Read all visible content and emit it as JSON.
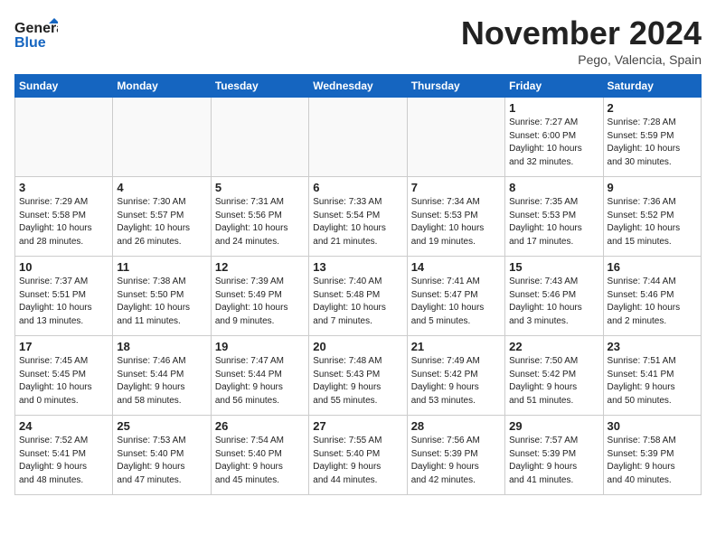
{
  "header": {
    "logo_general": "General",
    "logo_blue": "Blue",
    "month": "November 2024",
    "location": "Pego, Valencia, Spain"
  },
  "weekdays": [
    "Sunday",
    "Monday",
    "Tuesday",
    "Wednesday",
    "Thursday",
    "Friday",
    "Saturday"
  ],
  "weeks": [
    [
      {
        "day": "",
        "info": ""
      },
      {
        "day": "",
        "info": ""
      },
      {
        "day": "",
        "info": ""
      },
      {
        "day": "",
        "info": ""
      },
      {
        "day": "",
        "info": ""
      },
      {
        "day": "1",
        "info": "Sunrise: 7:27 AM\nSunset: 6:00 PM\nDaylight: 10 hours\nand 32 minutes."
      },
      {
        "day": "2",
        "info": "Sunrise: 7:28 AM\nSunset: 5:59 PM\nDaylight: 10 hours\nand 30 minutes."
      }
    ],
    [
      {
        "day": "3",
        "info": "Sunrise: 7:29 AM\nSunset: 5:58 PM\nDaylight: 10 hours\nand 28 minutes."
      },
      {
        "day": "4",
        "info": "Sunrise: 7:30 AM\nSunset: 5:57 PM\nDaylight: 10 hours\nand 26 minutes."
      },
      {
        "day": "5",
        "info": "Sunrise: 7:31 AM\nSunset: 5:56 PM\nDaylight: 10 hours\nand 24 minutes."
      },
      {
        "day": "6",
        "info": "Sunrise: 7:33 AM\nSunset: 5:54 PM\nDaylight: 10 hours\nand 21 minutes."
      },
      {
        "day": "7",
        "info": "Sunrise: 7:34 AM\nSunset: 5:53 PM\nDaylight: 10 hours\nand 19 minutes."
      },
      {
        "day": "8",
        "info": "Sunrise: 7:35 AM\nSunset: 5:53 PM\nDaylight: 10 hours\nand 17 minutes."
      },
      {
        "day": "9",
        "info": "Sunrise: 7:36 AM\nSunset: 5:52 PM\nDaylight: 10 hours\nand 15 minutes."
      }
    ],
    [
      {
        "day": "10",
        "info": "Sunrise: 7:37 AM\nSunset: 5:51 PM\nDaylight: 10 hours\nand 13 minutes."
      },
      {
        "day": "11",
        "info": "Sunrise: 7:38 AM\nSunset: 5:50 PM\nDaylight: 10 hours\nand 11 minutes."
      },
      {
        "day": "12",
        "info": "Sunrise: 7:39 AM\nSunset: 5:49 PM\nDaylight: 10 hours\nand 9 minutes."
      },
      {
        "day": "13",
        "info": "Sunrise: 7:40 AM\nSunset: 5:48 PM\nDaylight: 10 hours\nand 7 minutes."
      },
      {
        "day": "14",
        "info": "Sunrise: 7:41 AM\nSunset: 5:47 PM\nDaylight: 10 hours\nand 5 minutes."
      },
      {
        "day": "15",
        "info": "Sunrise: 7:43 AM\nSunset: 5:46 PM\nDaylight: 10 hours\nand 3 minutes."
      },
      {
        "day": "16",
        "info": "Sunrise: 7:44 AM\nSunset: 5:46 PM\nDaylight: 10 hours\nand 2 minutes."
      }
    ],
    [
      {
        "day": "17",
        "info": "Sunrise: 7:45 AM\nSunset: 5:45 PM\nDaylight: 10 hours\nand 0 minutes."
      },
      {
        "day": "18",
        "info": "Sunrise: 7:46 AM\nSunset: 5:44 PM\nDaylight: 9 hours\nand 58 minutes."
      },
      {
        "day": "19",
        "info": "Sunrise: 7:47 AM\nSunset: 5:44 PM\nDaylight: 9 hours\nand 56 minutes."
      },
      {
        "day": "20",
        "info": "Sunrise: 7:48 AM\nSunset: 5:43 PM\nDaylight: 9 hours\nand 55 minutes."
      },
      {
        "day": "21",
        "info": "Sunrise: 7:49 AM\nSunset: 5:42 PM\nDaylight: 9 hours\nand 53 minutes."
      },
      {
        "day": "22",
        "info": "Sunrise: 7:50 AM\nSunset: 5:42 PM\nDaylight: 9 hours\nand 51 minutes."
      },
      {
        "day": "23",
        "info": "Sunrise: 7:51 AM\nSunset: 5:41 PM\nDaylight: 9 hours\nand 50 minutes."
      }
    ],
    [
      {
        "day": "24",
        "info": "Sunrise: 7:52 AM\nSunset: 5:41 PM\nDaylight: 9 hours\nand 48 minutes."
      },
      {
        "day": "25",
        "info": "Sunrise: 7:53 AM\nSunset: 5:40 PM\nDaylight: 9 hours\nand 47 minutes."
      },
      {
        "day": "26",
        "info": "Sunrise: 7:54 AM\nSunset: 5:40 PM\nDaylight: 9 hours\nand 45 minutes."
      },
      {
        "day": "27",
        "info": "Sunrise: 7:55 AM\nSunset: 5:40 PM\nDaylight: 9 hours\nand 44 minutes."
      },
      {
        "day": "28",
        "info": "Sunrise: 7:56 AM\nSunset: 5:39 PM\nDaylight: 9 hours\nand 42 minutes."
      },
      {
        "day": "29",
        "info": "Sunrise: 7:57 AM\nSunset: 5:39 PM\nDaylight: 9 hours\nand 41 minutes."
      },
      {
        "day": "30",
        "info": "Sunrise: 7:58 AM\nSunset: 5:39 PM\nDaylight: 9 hours\nand 40 minutes."
      }
    ]
  ]
}
